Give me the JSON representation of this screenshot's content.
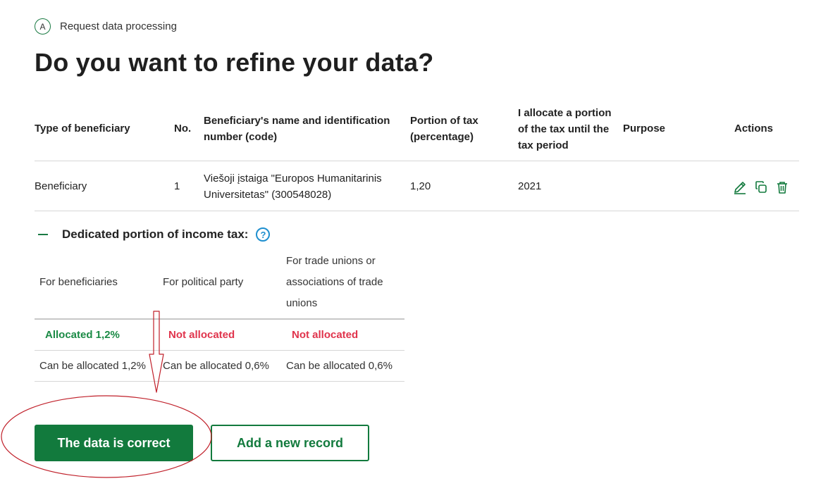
{
  "step": {
    "badge": "A",
    "label": "Request data processing"
  },
  "page_title": "Do you want to refine your data?",
  "table": {
    "headers": {
      "type": "Type of beneficiary",
      "no": "No.",
      "name_l1": "Beneficiary's name and identification",
      "name_l2": "number (code)",
      "portion_l1": "Portion of tax",
      "portion_l2": "(percentage)",
      "until_l1": "I allocate a portion",
      "until_l2": "of the tax until the",
      "until_l3": "tax period",
      "purpose": "Purpose",
      "actions": "Actions"
    },
    "rows": [
      {
        "type": "Beneficiary",
        "no": "1",
        "name_l1": "Viešoji įstaiga \"Europos Humanitarinis",
        "name_l2": "Universitetas\" (300548028)",
        "portion": "1,20",
        "until": "2021",
        "purpose": "",
        "action_icons": [
          "edit-icon",
          "copy-icon",
          "delete-icon"
        ]
      }
    ]
  },
  "dedicated": {
    "title": "Dedicated portion of income tax:",
    "help_icon": "question-icon",
    "headers": {
      "beneficiaries": "For beneficiaries",
      "party": "For political party",
      "unions_l1": "For trade unions or",
      "unions_l2": "associations of trade",
      "unions_l3": "unions"
    },
    "status": {
      "beneficiaries": "Allocated 1,2%",
      "party": "Not allocated",
      "unions": "Not allocated"
    },
    "available": {
      "beneficiaries": "Can be allocated 1,2%",
      "party": "Can be allocated 0,6%",
      "unions": "Can be allocated 0,6%"
    }
  },
  "buttons": {
    "primary": "The data is correct",
    "secondary": "Add a new record"
  },
  "colors": {
    "brand_green": "#127a3d",
    "allocated_green": "#1a8a45",
    "not_allocated_red": "#e0344c",
    "help_blue": "#1e8fcf",
    "annotation_red": "#c0202a"
  }
}
